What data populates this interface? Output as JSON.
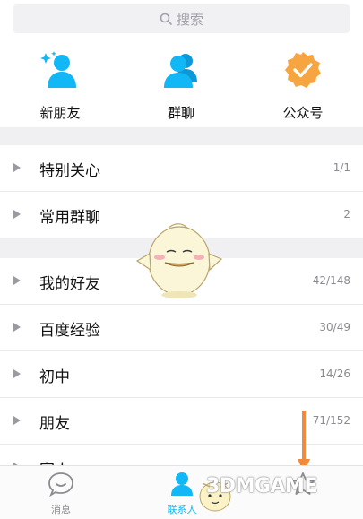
{
  "search": {
    "placeholder": "搜索"
  },
  "quick_actions": [
    {
      "label": "新朋友",
      "icon": "add-friend-icon"
    },
    {
      "label": "群聊",
      "icon": "group-chat-icon"
    },
    {
      "label": "公众号",
      "icon": "official-account-icon"
    }
  ],
  "groups_top": [
    {
      "title": "特别关心",
      "count": "1/1"
    },
    {
      "title": "常用群聊",
      "count": "2"
    }
  ],
  "friend_groups": [
    {
      "title": "我的好友",
      "count": "42/148"
    },
    {
      "title": "百度经验",
      "count": "30/49"
    },
    {
      "title": "初中",
      "count": "14/26"
    },
    {
      "title": "朋友",
      "count": "71/152"
    },
    {
      "title": "家人",
      "count": ""
    }
  ],
  "tabbar": {
    "messages": "消息",
    "contacts": "联系人",
    "dynamic": ""
  },
  "watermark": {
    "text": "3DMGAME"
  },
  "colors": {
    "accent": "#12b7f5",
    "badge_orange": "#f7a540",
    "annotation_arrow": "#f08a3c"
  }
}
